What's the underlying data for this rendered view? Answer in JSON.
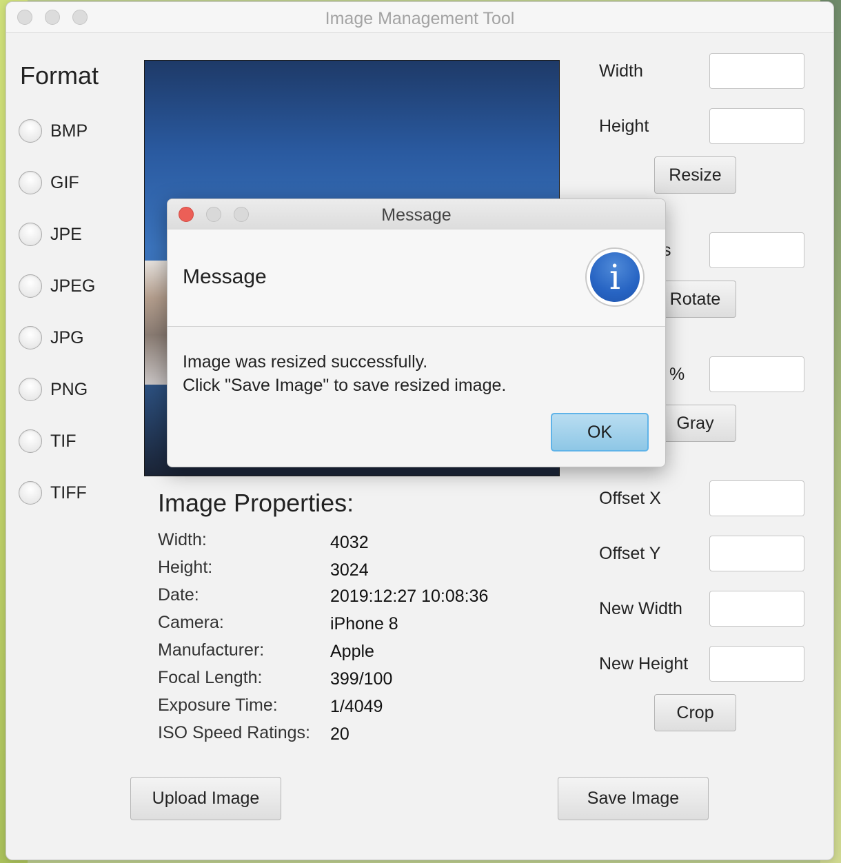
{
  "window": {
    "title": "Image Management Tool"
  },
  "format": {
    "title": "Format",
    "options": [
      "BMP",
      "GIF",
      "JPE",
      "JPEG",
      "JPG",
      "PNG",
      "TIF",
      "TIFF"
    ]
  },
  "resize": {
    "width_label": "Width",
    "height_label": "Height",
    "button": "Resize"
  },
  "rotate": {
    "label_fragment": "s",
    "button": "Rotate"
  },
  "gray": {
    "label_fragment": "%",
    "button": "Gray"
  },
  "crop": {
    "offset_x_label": "Offset X",
    "offset_y_label": "Offset Y",
    "new_width_label": "New Width",
    "new_height_label": "New Height",
    "button": "Crop"
  },
  "properties": {
    "title": "Image Properties:",
    "rows": [
      {
        "key": "Width:",
        "value": "4032"
      },
      {
        "key": "Height:",
        "value": "3024"
      },
      {
        "key": "Date:",
        "value": "2019:12:27 10:08:36"
      },
      {
        "key": "Camera:",
        "value": "iPhone 8"
      },
      {
        "key": "Manufacturer:",
        "value": "Apple"
      },
      {
        "key": "Focal Length:",
        "value": "399/100"
      },
      {
        "key": "Exposure Time:",
        "value": "1/4049"
      },
      {
        "key": "ISO Speed Ratings:",
        "value": "20"
      }
    ]
  },
  "actions": {
    "upload": "Upload Image",
    "save": "Save Image"
  },
  "dialog": {
    "title": "Message",
    "header": "Message",
    "icon_glyph": "i",
    "line1": "Image was resized successfully.",
    "line2": "Click \"Save Image\" to save resized image.",
    "ok": "OK"
  }
}
